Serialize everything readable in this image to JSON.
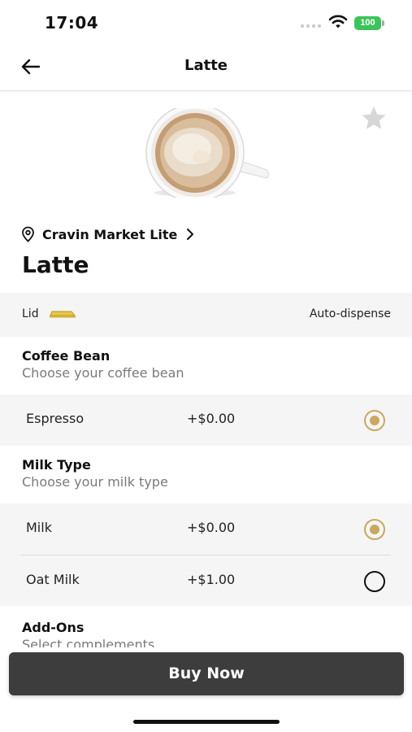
{
  "status_bar": {
    "time": "17:04",
    "battery": "100",
    "battery_color": "#3cc35b"
  },
  "nav": {
    "title": "Latte",
    "back_icon": "arrow-left-icon"
  },
  "product": {
    "image": "latte-cup-image",
    "favorite_icon": "star-icon",
    "store_icon": "location-pin-icon",
    "store_name": "Cravin Market Lite",
    "title": "Latte"
  },
  "lid": {
    "label": "Lid",
    "icon": "lid-icon",
    "value": "Auto-dispense"
  },
  "coffee_bean": {
    "title": "Coffee Bean",
    "subtitle": "Choose your coffee bean",
    "options": [
      {
        "name": "Espresso",
        "price": "+$0.00",
        "selected": true
      }
    ]
  },
  "milk_type": {
    "title": "Milk Type",
    "subtitle": "Choose your milk type",
    "options": [
      {
        "name": "Milk",
        "price": "+$0.00",
        "selected": true
      },
      {
        "name": "Oat Milk",
        "price": "+$1.00",
        "selected": false
      }
    ]
  },
  "addons": {
    "title": "Add-Ons",
    "subtitle": "Select complements"
  },
  "buy_button": {
    "label": "Buy Now",
    "color": "#3d3d3d"
  },
  "accent_color": "#c9a961"
}
